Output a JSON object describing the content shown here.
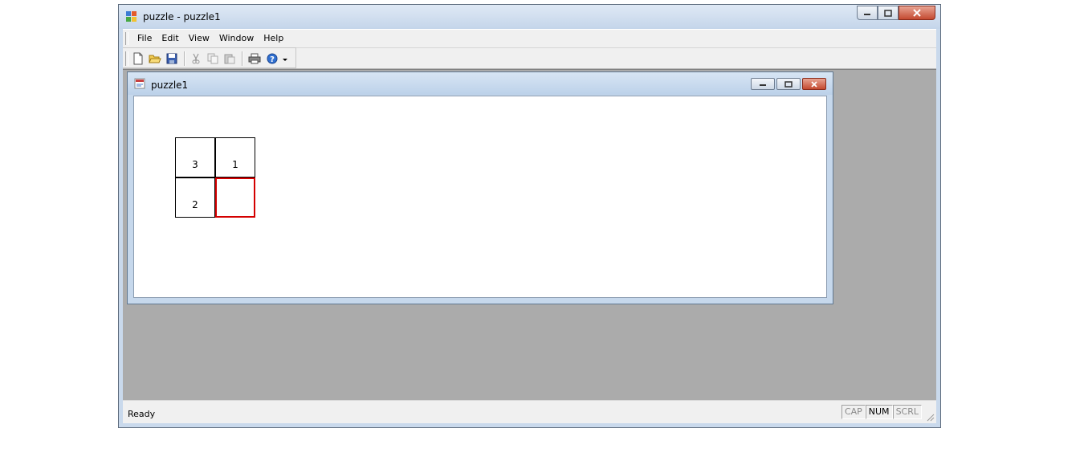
{
  "app": {
    "title": "puzzle - puzzle1",
    "icon": "app-icon"
  },
  "menu": {
    "items": [
      "File",
      "Edit",
      "View",
      "Window",
      "Help"
    ]
  },
  "toolbar": {
    "buttons": [
      "new-icon",
      "open-icon",
      "save-icon",
      "cut-icon",
      "copy-icon",
      "paste-icon",
      "print-icon",
      "help-icon"
    ]
  },
  "child": {
    "title": "puzzle1"
  },
  "puzzle": {
    "tiles": [
      "3",
      "1",
      "2",
      ""
    ],
    "empty_border_color": "#d40000"
  },
  "status": {
    "text": "Ready",
    "indicators": [
      {
        "label": "CAP",
        "active": false
      },
      {
        "label": "NUM",
        "active": true
      },
      {
        "label": "SCRL",
        "active": false
      }
    ]
  }
}
